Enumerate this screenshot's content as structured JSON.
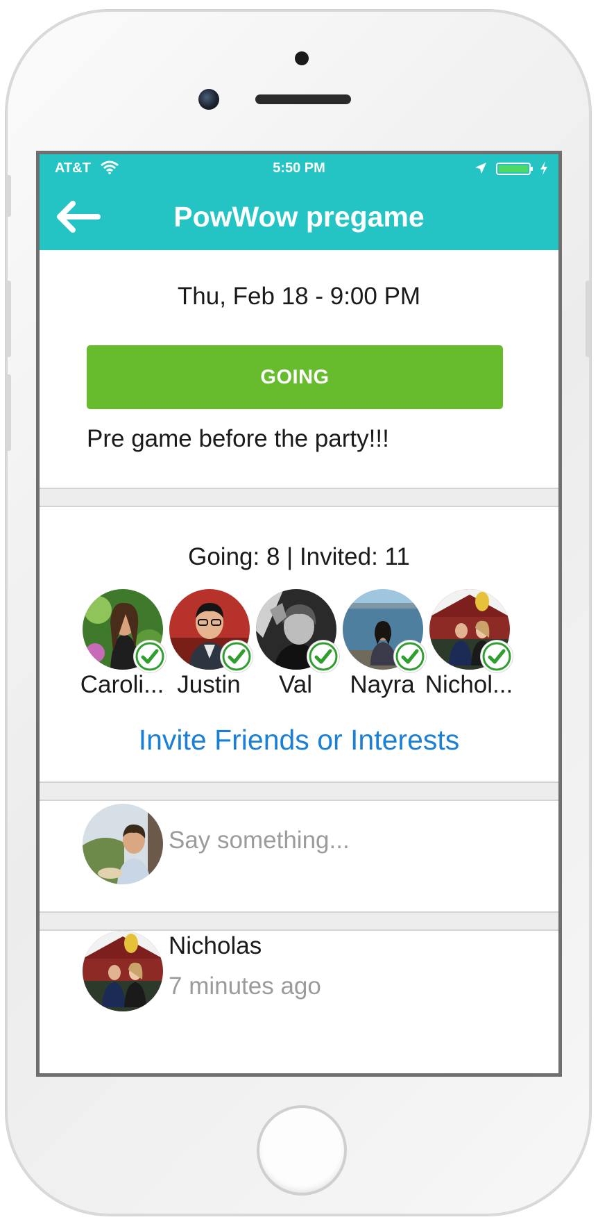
{
  "status_bar": {
    "carrier": "AT&T",
    "time": "5:50 PM",
    "icons": [
      "wifi-icon",
      "location-arrow-icon",
      "battery-icon",
      "charging-bolt-icon"
    ]
  },
  "nav": {
    "title": "PowWow pregame",
    "back_icon": "back-arrow-icon"
  },
  "event": {
    "datetime": "Thu, Feb 18 - 9:00 PM",
    "rsvp_label": "GOING",
    "description": "Pre game before the party!!!"
  },
  "attendance": {
    "summary": "Going: 8 | Invited: 11",
    "attendees": [
      {
        "name": "Caroli..."
      },
      {
        "name": "Justin"
      },
      {
        "name": "Val"
      },
      {
        "name": "Nayra"
      },
      {
        "name": "Nichol..."
      }
    ],
    "invite_link": "Invite Friends or Interests"
  },
  "composer": {
    "placeholder": "Say something..."
  },
  "posts": [
    {
      "author": "Nicholas",
      "time": "7 minutes ago"
    }
  ],
  "colors": {
    "header": "#24c4c4",
    "going_button": "#66bc2c",
    "link": "#1a7fd6",
    "muted_text": "#9b9b9b",
    "check": "#2f9e2f"
  }
}
